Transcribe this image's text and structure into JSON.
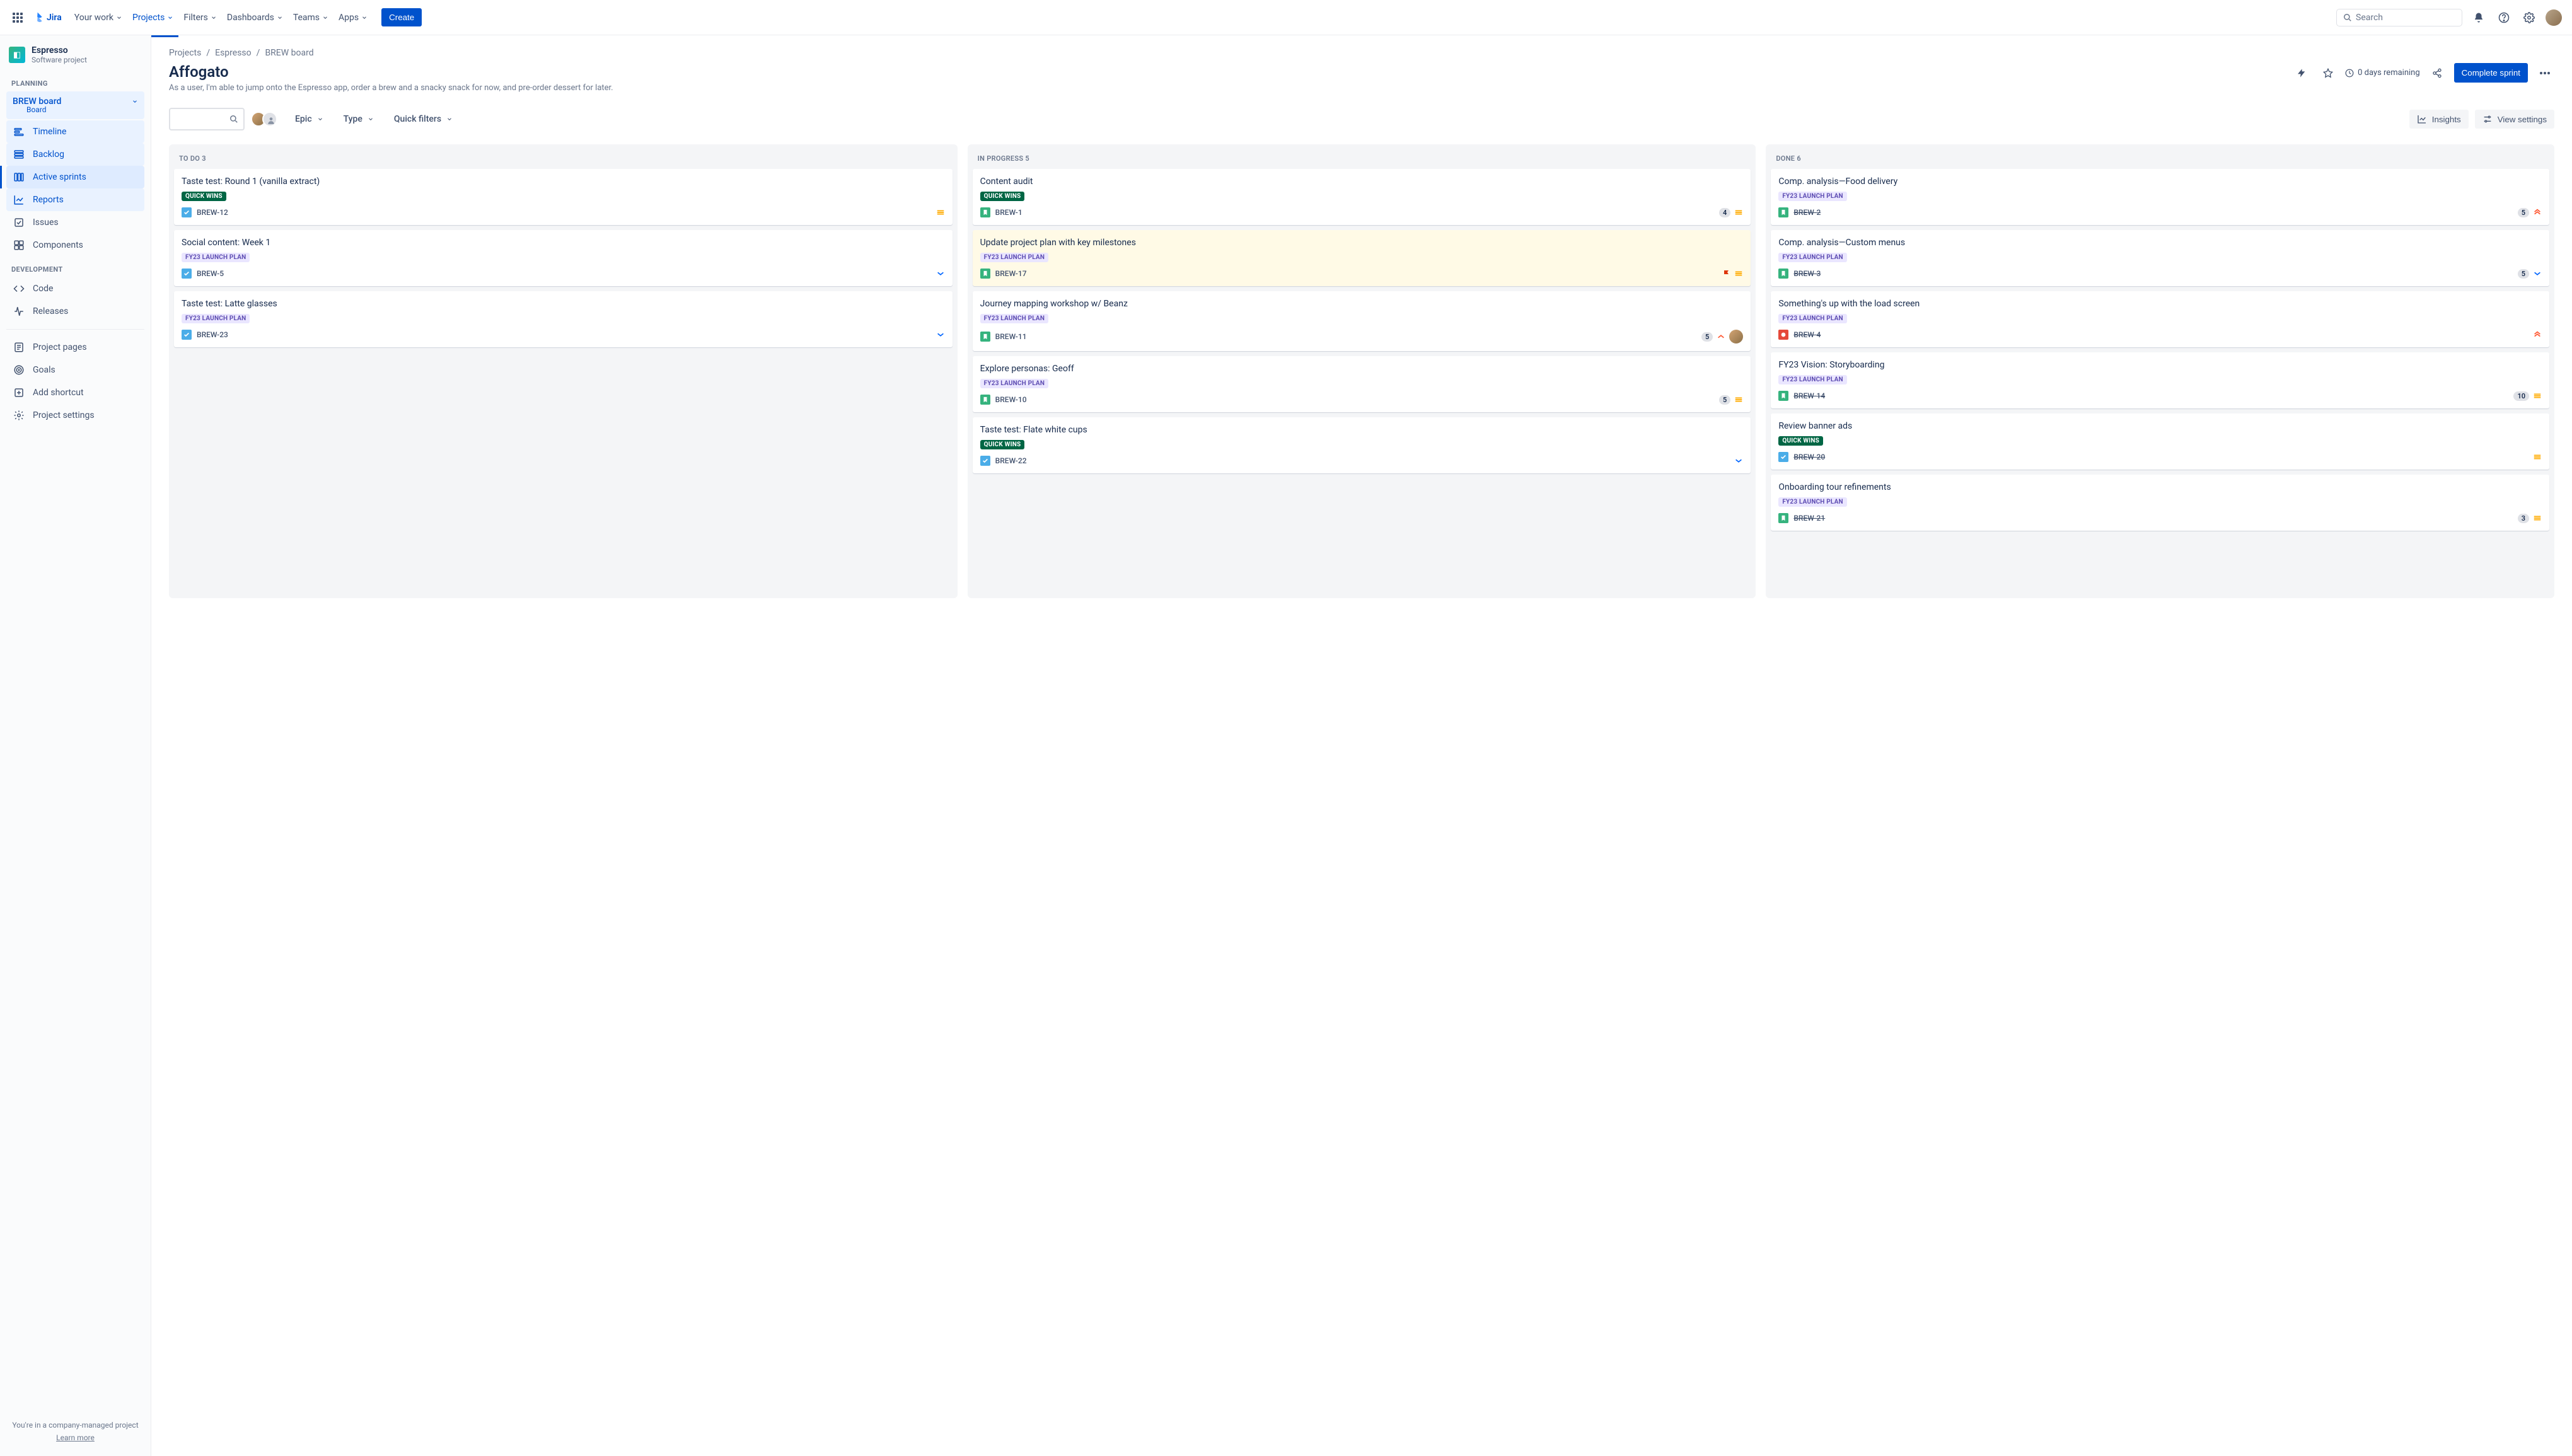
{
  "nav": {
    "product": "Jira",
    "items": [
      "Your work",
      "Projects",
      "Filters",
      "Dashboards",
      "Teams",
      "Apps"
    ],
    "active_index": 1,
    "create": "Create",
    "search_placeholder": "Search"
  },
  "sidebar": {
    "project_name": "Espresso",
    "project_type": "Software project",
    "sections": {
      "planning_label": "PLANNING",
      "development_label": "DEVELOPMENT"
    },
    "board": {
      "name": "BREW board",
      "sub": "Board"
    },
    "planning_items": [
      "Timeline",
      "Backlog",
      "Active sprints",
      "Reports"
    ],
    "planning_active_index": 2,
    "other_items": [
      "Issues",
      "Components"
    ],
    "dev_items": [
      "Code",
      "Releases"
    ],
    "bottom_items": [
      "Project pages",
      "Goals",
      "Add shortcut",
      "Project settings"
    ],
    "footer_line": "You're in a company-managed project",
    "footer_link": "Learn more"
  },
  "header": {
    "breadcrumbs": [
      "Projects",
      "Espresso",
      "BREW board"
    ],
    "title": "Affogato",
    "subtitle": "As a user, I'm able to jump onto the Espresso app, order a brew and a snacky snack for now, and pre-order dessert for later.",
    "days_remaining": "0 days remaining",
    "complete_sprint": "Complete sprint"
  },
  "toolbar": {
    "filters": [
      "Epic",
      "Type",
      "Quick filters"
    ],
    "insights": "Insights",
    "view_settings": "View settings"
  },
  "columns": [
    {
      "name": "TO DO",
      "count": 3,
      "cards": [
        {
          "title": "Taste test: Round 1 (vanilla extract)",
          "labels": [
            "quick"
          ],
          "type": "task",
          "key": "BREW-12",
          "priority": "medium"
        },
        {
          "title": "Social content: Week 1",
          "labels": [
            "fy"
          ],
          "type": "task",
          "key": "BREW-5",
          "priority": "low"
        },
        {
          "title": "Taste test: Latte glasses",
          "labels": [
            "fy"
          ],
          "type": "task",
          "key": "BREW-23",
          "priority": "low"
        }
      ]
    },
    {
      "name": "IN PROGRESS",
      "count": 5,
      "cards": [
        {
          "title": "Content audit",
          "labels": [
            "quick"
          ],
          "type": "story",
          "key": "BREW-1",
          "estimate": "4",
          "priority": "medium"
        },
        {
          "title": "Update project plan with key milestones",
          "labels": [
            "fy"
          ],
          "type": "story",
          "key": "BREW-17",
          "flagged": true,
          "priority": "medium",
          "hl": true
        },
        {
          "title": "Journey mapping workshop w/ Beanz",
          "labels": [
            "fy"
          ],
          "type": "story",
          "key": "BREW-11",
          "estimate": "5",
          "priority": "high",
          "assignee": true
        },
        {
          "title": "Explore personas: Geoff",
          "labels": [
            "fy"
          ],
          "type": "story",
          "key": "BREW-10",
          "estimate": "5",
          "priority": "medium"
        },
        {
          "title": "Taste test: Flate white cups",
          "labels": [
            "quick"
          ],
          "type": "task",
          "key": "BREW-22",
          "priority": "low"
        }
      ]
    },
    {
      "name": "DONE",
      "count": 6,
      "cards": [
        {
          "title": "Comp. analysis—Food delivery",
          "labels": [
            "fy"
          ],
          "type": "story",
          "key": "BREW-2",
          "done": true,
          "estimate": "5",
          "priority": "highest"
        },
        {
          "title": "Comp. analysis—Custom menus",
          "labels": [
            "fy"
          ],
          "type": "story",
          "key": "BREW-3",
          "done": true,
          "estimate": "5",
          "priority": "low"
        },
        {
          "title": "Something's up with the load screen",
          "labels": [
            "fy"
          ],
          "type": "bug",
          "key": "BREW-4",
          "done": true,
          "priority": "highest"
        },
        {
          "title": "FY23 Vision: Storyboarding",
          "labels": [
            "fy"
          ],
          "type": "story",
          "key": "BREW-14",
          "done": true,
          "estimate": "10",
          "priority": "medium"
        },
        {
          "title": "Review banner ads",
          "labels": [
            "quick"
          ],
          "type": "task",
          "key": "BREW-20",
          "done": true,
          "priority": "medium"
        },
        {
          "title": "Onboarding tour refinements",
          "labels": [
            "fy"
          ],
          "type": "story",
          "key": "BREW-21",
          "done": true,
          "estimate": "3",
          "priority": "medium"
        }
      ]
    }
  ],
  "label_text": {
    "quick": "QUICK WINS",
    "fy": "FY23 LAUNCH PLAN"
  }
}
